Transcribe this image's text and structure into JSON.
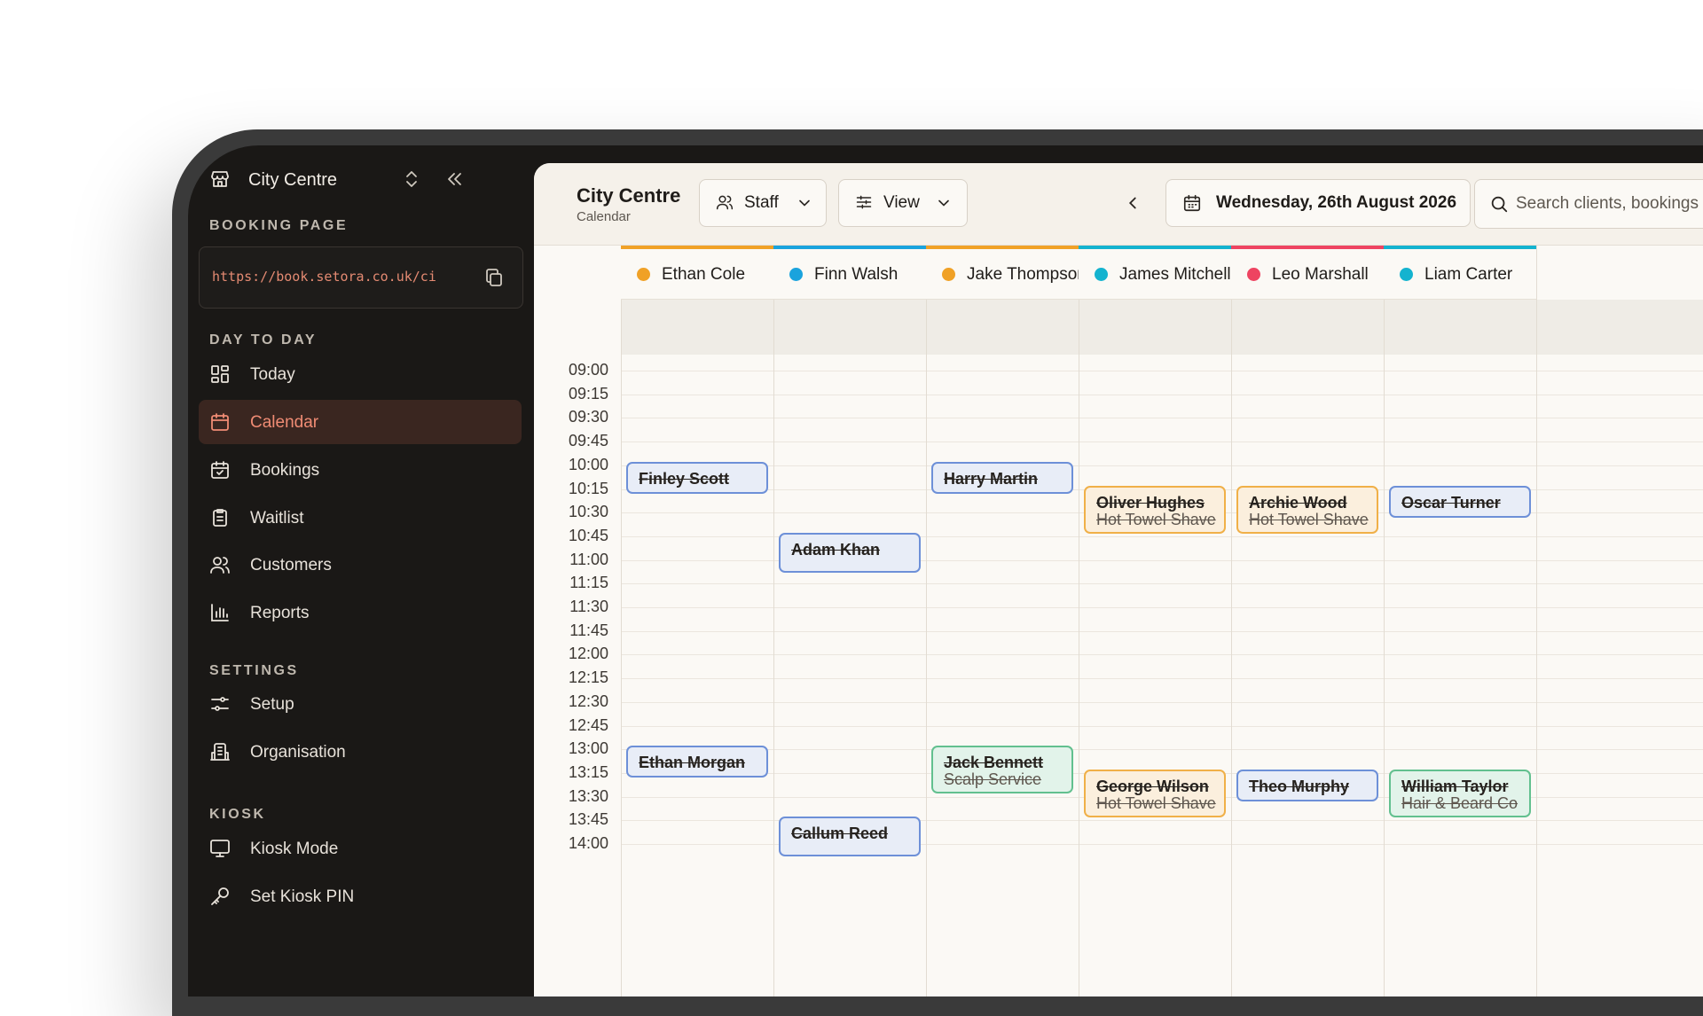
{
  "sidebar": {
    "workspace": "City Centre",
    "booking_page_label": "BOOKING PAGE",
    "booking_url": "https://book.setora.co.uk/ci",
    "day_to_day_label": "DAY TO DAY",
    "settings_label": "SETTINGS",
    "kiosk_label": "KIOSK",
    "items": [
      {
        "label": "Today",
        "icon": "dashboard-icon"
      },
      {
        "label": "Calendar",
        "icon": "calendar-icon",
        "active": true
      },
      {
        "label": "Bookings",
        "icon": "calendar-check-icon"
      },
      {
        "label": "Waitlist",
        "icon": "clipboard-list-icon"
      },
      {
        "label": "Customers",
        "icon": "users-icon"
      },
      {
        "label": "Reports",
        "icon": "bar-chart-icon"
      },
      {
        "label": "Setup",
        "icon": "sliders-icon"
      },
      {
        "label": "Organisation",
        "icon": "building-icon"
      },
      {
        "label": "Kiosk Mode",
        "icon": "monitor-icon"
      },
      {
        "label": "Set Kiosk PIN",
        "icon": "key-icon"
      }
    ]
  },
  "header": {
    "title": "City Centre",
    "subtitle": "Calendar",
    "staff_label": "Staff",
    "view_label": "View",
    "date_label": "Wednesday, 26th August 2026",
    "search_placeholder": "Search clients, bookings"
  },
  "staff": [
    {
      "name": "Ethan Cole",
      "color": "#f0a126"
    },
    {
      "name": "Finn Walsh",
      "color": "#1aa3dd"
    },
    {
      "name": "Jake Thompson",
      "color": "#f0a126"
    },
    {
      "name": "James Mitchell",
      "color": "#14b3cf"
    },
    {
      "name": "Leo Marshall",
      "color": "#ee4461"
    },
    {
      "name": "Liam Carter",
      "color": "#14b3cf"
    }
  ],
  "times": [
    "09:00",
    "09:15",
    "09:30",
    "09:45",
    "10:00",
    "10:15",
    "10:30",
    "10:45",
    "11:00",
    "11:15",
    "11:30",
    "11:45",
    "12:00",
    "12:15",
    "12:30",
    "12:45",
    "13:00",
    "13:15",
    "13:30",
    "13:45",
    "14:00"
  ],
  "appointments": [
    {
      "staff": 0,
      "client": "Finley Scott",
      "service": "",
      "start": "10:00",
      "style": "blue"
    },
    {
      "staff": 2,
      "client": "Harry Martin",
      "service": "",
      "start": "10:00",
      "style": "blue"
    },
    {
      "staff": 3,
      "client": "Oliver Hughes",
      "service": "Hot Towel Shave",
      "start": "10:15",
      "style": "orange"
    },
    {
      "staff": 4,
      "client": "Archie Wood",
      "service": "Hot Towel Shave",
      "start": "10:15",
      "style": "orange"
    },
    {
      "staff": 5,
      "client": "Oscar Turner",
      "service": "",
      "start": "10:15",
      "style": "blue"
    },
    {
      "staff": 1,
      "client": "Adam Khan",
      "service": "",
      "start": "10:45",
      "style": "blue"
    },
    {
      "staff": 0,
      "client": "Ethan Morgan",
      "service": "",
      "start": "13:00",
      "style": "blue"
    },
    {
      "staff": 2,
      "client": "Jack Bennett",
      "service": "Scalp Service",
      "start": "13:00",
      "style": "green"
    },
    {
      "staff": 3,
      "client": "George Wilson",
      "service": "Hot Towel Shave",
      "start": "13:15",
      "style": "orange"
    },
    {
      "staff": 4,
      "client": "Theo Murphy",
      "service": "",
      "start": "13:15",
      "style": "blue"
    },
    {
      "staff": 5,
      "client": "William Taylor",
      "service": "Hair & Beard Co",
      "start": "13:15",
      "style": "green"
    },
    {
      "staff": 1,
      "client": "Callum Reed",
      "service": "",
      "start": "13:45",
      "style": "blue"
    }
  ]
}
